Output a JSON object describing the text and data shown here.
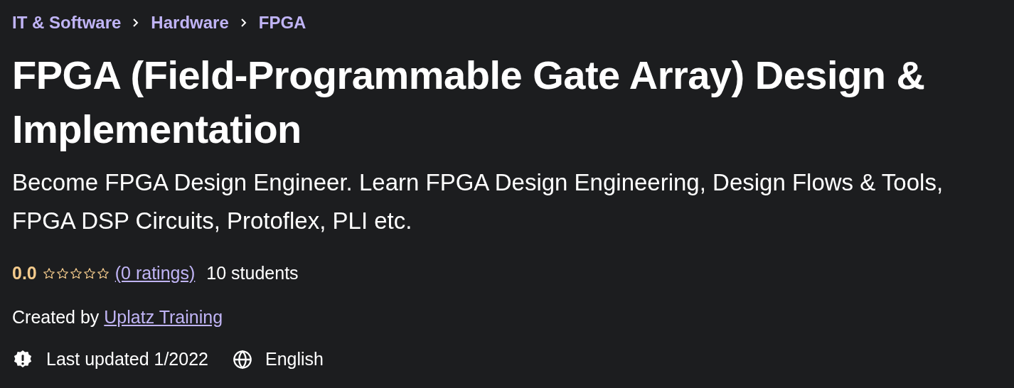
{
  "breadcrumbs": [
    {
      "label": "IT & Software"
    },
    {
      "label": "Hardware"
    },
    {
      "label": "FPGA"
    }
  ],
  "title": "FPGA (Field-Programmable Gate Array) Design & Implementation",
  "subtitle": "Become FPGA Design Engineer. Learn FPGA Design Engineering, Design Flows & Tools, FPGA DSP Circuits, Protoflex, PLI etc.",
  "rating": {
    "score": "0.0",
    "stars": 0,
    "ratings_link": "(0 ratings)",
    "students": "10 students"
  },
  "created_by": {
    "label": "Created by",
    "author": "Uplatz Training"
  },
  "meta": {
    "last_updated": "Last updated 1/2022",
    "language": "English"
  }
}
